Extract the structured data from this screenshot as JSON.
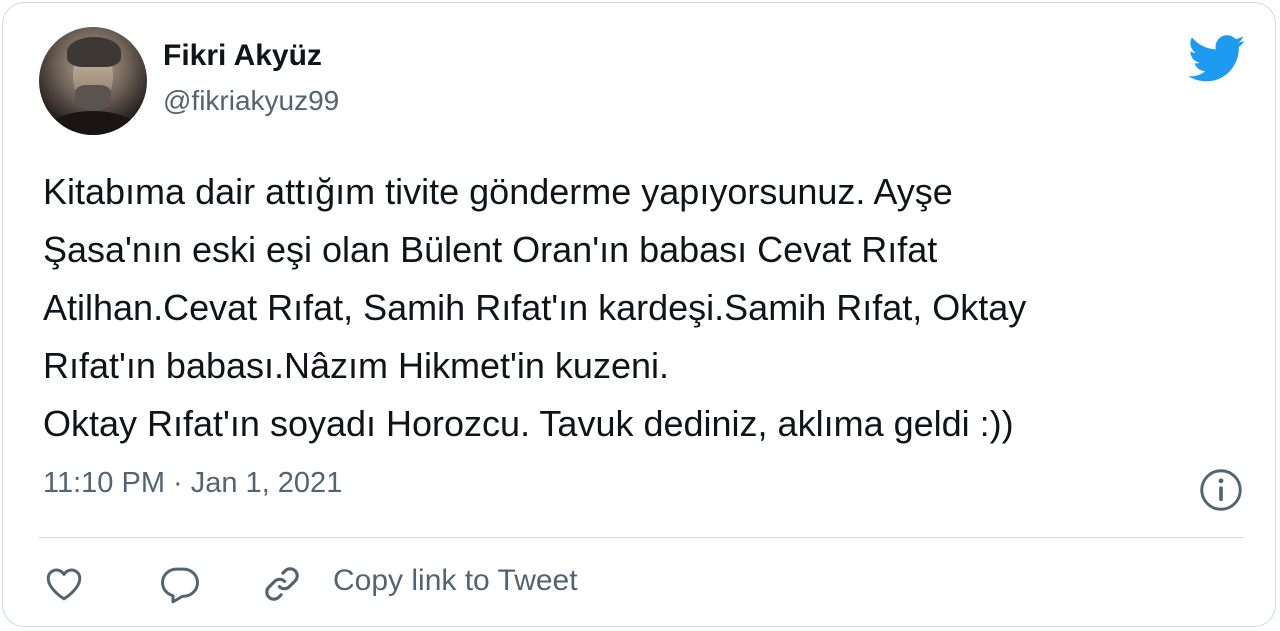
{
  "author": {
    "name": "Fikri Akyüz",
    "handle": "@fikriakyuz99"
  },
  "tweet": {
    "text": "Kitabıma dair attığım tivite gönderme yapıyorsunuz. Ayşe\nŞasa'nın eski eşi olan Bülent Oran'ın babası Cevat Rıfat\nAtilhan.Cevat Rıfat, Samih Rıfat'ın kardeşi.Samih Rıfat, Oktay\nRıfat'ın babası.Nâzım Hikmet'in kuzeni.\nOktay Rıfat'ın soyadı Horozcu. Tavuk dediniz, aklıma geldi :))",
    "timestamp": "11:10 PM · Jan 1, 2021"
  },
  "actions": {
    "copy_link_label": "Copy link to Tweet"
  },
  "icons": {
    "brand": "twitter-bird-icon",
    "info": "info-icon",
    "like": "heart-icon",
    "reply": "reply-icon",
    "link": "link-icon"
  },
  "colors": {
    "brand": "#1d9bf0",
    "text_primary": "#0f1419",
    "text_secondary": "#536471",
    "border": "#cfd9de"
  }
}
